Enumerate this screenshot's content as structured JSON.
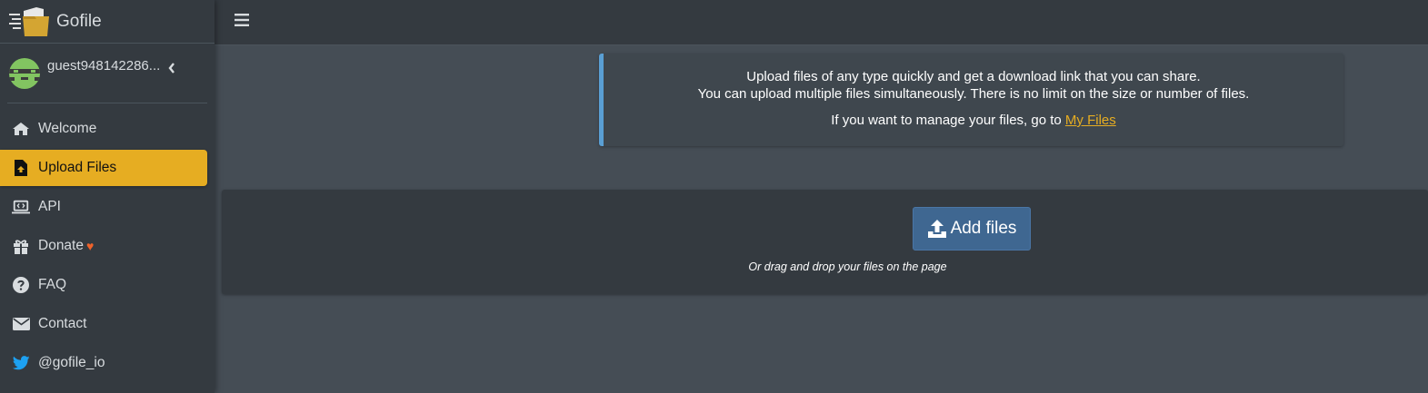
{
  "brand": {
    "name": "Gofile"
  },
  "user": {
    "name": "guest948142286..."
  },
  "nav": [
    {
      "label": "Welcome",
      "icon": "home-icon",
      "active": false
    },
    {
      "label": "Upload Files",
      "icon": "file-upload-icon",
      "active": true
    },
    {
      "label": "API",
      "icon": "laptop-code-icon",
      "active": false
    },
    {
      "label": "Donate",
      "icon": "gift-icon",
      "active": false,
      "suffix": "♥"
    },
    {
      "label": "FAQ",
      "icon": "question-circle-icon",
      "active": false
    },
    {
      "label": "Contact",
      "icon": "envelope-icon",
      "active": false
    },
    {
      "label": "@gofile_io",
      "icon": "twitter-icon",
      "active": false
    }
  ],
  "callout": {
    "line1": "Upload files of any type quickly and get a download link that you can share.",
    "line2": "You can upload multiple files simultaneously. There is no limit on the size or number of files.",
    "line3_prefix": "If you want to manage your files, go to ",
    "line3_link": "My Files"
  },
  "upload": {
    "button_label": "Add files",
    "drag_hint": "Or drag and drop your files on the page"
  },
  "colors": {
    "accent": "#e6ad22",
    "sidebar_bg": "#343a40",
    "content_bg": "#454d55",
    "button_bg": "#3f6791",
    "callout_border": "#5a9fd4",
    "heart": "#f0622a",
    "twitter": "#1da1f2"
  }
}
